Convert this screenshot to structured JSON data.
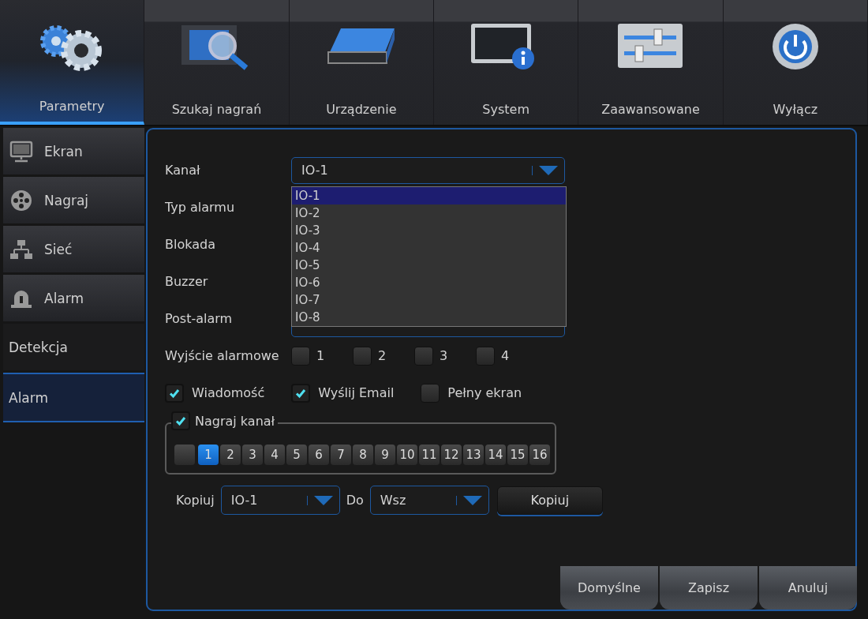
{
  "top_tabs": [
    {
      "label": "Parametry",
      "selected": true
    },
    {
      "label": "Szukaj nagrań",
      "selected": false
    },
    {
      "label": "Urządzenie",
      "selected": false
    },
    {
      "label": "System",
      "selected": false
    },
    {
      "label": "Zaawansowane",
      "selected": false
    },
    {
      "label": "Wyłącz",
      "selected": false
    }
  ],
  "sidebar": {
    "items": [
      {
        "label": "Ekran",
        "kind": "icon",
        "selected": false
      },
      {
        "label": "Nagraj",
        "kind": "icon",
        "selected": false
      },
      {
        "label": "Sieć",
        "kind": "icon",
        "selected": false
      },
      {
        "label": "Alarm",
        "kind": "icon",
        "selected": false
      },
      {
        "label": "Detekcja",
        "kind": "sub",
        "selected": false
      },
      {
        "label": "Alarm",
        "kind": "sub",
        "selected": true
      }
    ]
  },
  "form": {
    "channel": {
      "label": "Kanał",
      "value": "IO-1",
      "options": [
        {
          "label": "IO-1",
          "selected": true
        },
        {
          "label": "IO-2",
          "selected": false
        },
        {
          "label": "IO-3",
          "selected": false
        },
        {
          "label": "IO-4",
          "selected": false
        },
        {
          "label": "IO-5",
          "selected": false
        },
        {
          "label": "IO-6",
          "selected": false
        },
        {
          "label": "IO-7",
          "selected": false
        },
        {
          "label": "IO-8",
          "selected": false
        }
      ]
    },
    "labels": [
      "Typ alarmu",
      "Blokada",
      "Buzzer",
      "Post-alarm"
    ],
    "alarm_output": {
      "label": "Wyjście alarmowe",
      "outputs": [
        {
          "label": "1",
          "checked": false
        },
        {
          "label": "2",
          "checked": false
        },
        {
          "label": "3",
          "checked": false
        },
        {
          "label": "4",
          "checked": false
        }
      ]
    },
    "notifications": [
      {
        "label": "Wiadomość",
        "checked": true
      },
      {
        "label": "Wyślij Email",
        "checked": true
      },
      {
        "label": "Pełny ekran",
        "checked": false
      }
    ],
    "record_channel": {
      "label": "Nagraj kanał",
      "checked": true,
      "all_checked": false,
      "channels": [
        {
          "label": "1",
          "selected": true
        },
        {
          "label": "2",
          "selected": false
        },
        {
          "label": "3",
          "selected": false
        },
        {
          "label": "4",
          "selected": false
        },
        {
          "label": "5",
          "selected": false
        },
        {
          "label": "6",
          "selected": false
        },
        {
          "label": "7",
          "selected": false
        },
        {
          "label": "8",
          "selected": false
        },
        {
          "label": "9",
          "selected": false
        },
        {
          "label": "10",
          "selected": false
        },
        {
          "label": "11",
          "selected": false
        },
        {
          "label": "12",
          "selected": false
        },
        {
          "label": "13",
          "selected": false
        },
        {
          "label": "14",
          "selected": false
        },
        {
          "label": "15",
          "selected": false
        },
        {
          "label": "16",
          "selected": false
        }
      ]
    },
    "copy": {
      "label": "Kopiuj",
      "from": "IO-1",
      "to_label": "Do",
      "to": "Wsz",
      "button": "Kopiuj"
    }
  },
  "buttons": [
    "Domyślne",
    "Zapisz",
    "Anuluj"
  ]
}
